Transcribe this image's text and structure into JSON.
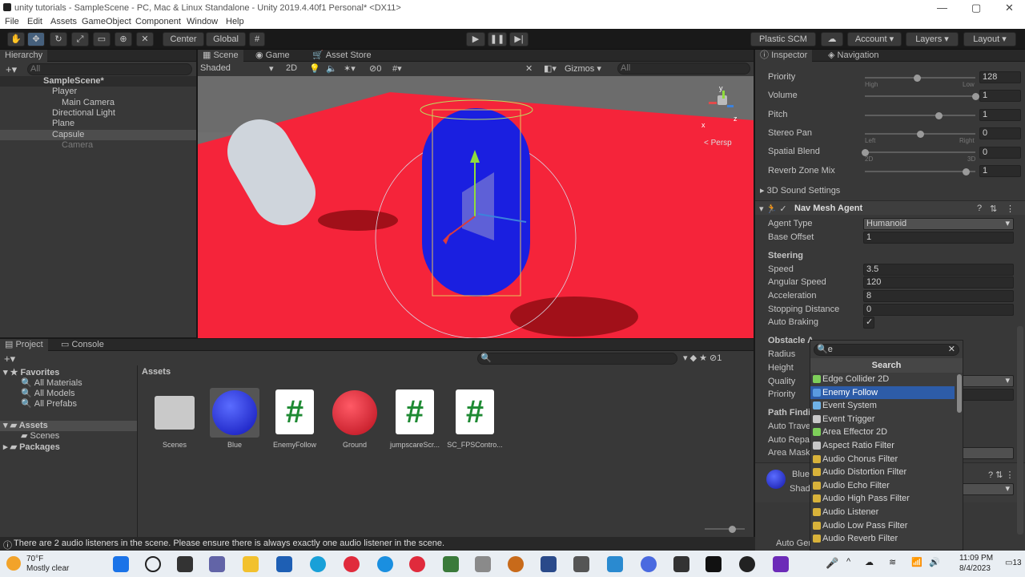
{
  "window": {
    "title": "unity tutorials - SampleScene - PC, Mac & Linux Standalone - Unity 2019.4.40f1 Personal* <DX11>"
  },
  "menu": [
    "File",
    "Edit",
    "Assets",
    "GameObject",
    "Component",
    "Window",
    "Help"
  ],
  "toolbar": {
    "center": "Center",
    "global": "Global",
    "plastic": "Plastic SCM",
    "account": "Account",
    "layers": "Layers",
    "layout": "Layout"
  },
  "hierarchy": {
    "tab": "Hierarchy",
    "search": "All",
    "scene": "SampleScene*",
    "items": [
      "Player",
      "Main Camera",
      "Directional Light",
      "Plane",
      "Capsule",
      "Camera"
    ]
  },
  "scene_view": {
    "tabs": [
      "Scene",
      "Game",
      "Asset Store"
    ],
    "shading": "Shaded",
    "mode2d": "2D",
    "fx_count": "0",
    "gizmos": "Gizmos",
    "search": "All",
    "persp": "< Persp",
    "axis_y": "y",
    "axis_x": "x",
    "axis_z": "z"
  },
  "inspector": {
    "tabs": [
      "Inspector",
      "Navigation"
    ],
    "audio": {
      "priority_label": "Priority",
      "priority": "128",
      "high": "High",
      "low": "Low",
      "priority_frac": 0.47,
      "volume_label": "Volume",
      "volume": "1",
      "volume_frac": 1.0,
      "pitch_label": "Pitch",
      "pitch": "1",
      "pitch_frac": 0.67,
      "stereo_label": "Stereo Pan",
      "stereo": "0",
      "left": "Left",
      "right": "Right",
      "stereo_frac": 0.5,
      "spatial_label": "Spatial Blend",
      "spatial": "0",
      "d2": "2D",
      "d3": "3D",
      "spatial_frac": 0.0,
      "reverb_label": "Reverb Zone Mix",
      "reverb": "1",
      "reverb_frac": 0.91,
      "sound3d": "3D Sound Settings"
    },
    "nav": {
      "title": "Nav Mesh Agent",
      "agent_type_label": "Agent Type",
      "agent_type": "Humanoid",
      "base_offset_label": "Base Offset",
      "base_offset": "1",
      "steering": "Steering",
      "speed_label": "Speed",
      "speed": "3.5",
      "angular_label": "Angular Speed",
      "angular": "120",
      "accel_label": "Acceleration",
      "accel": "8",
      "stopping_label": "Stopping Distance",
      "stopping": "0",
      "braking_label": "Auto Braking",
      "braking": "✓",
      "obstacle": "Obstacle A",
      "radius": "Radius",
      "height": "Height",
      "quality": "Quality",
      "priority": "Priority",
      "pathfind": "Path Findi",
      "autotrav": "Auto Trave",
      "autorep": "Auto Repat",
      "areamask": "Area Mask"
    },
    "material": {
      "name": "Blue",
      "shader": "Shad"
    },
    "autogen": "Auto Ger"
  },
  "dropdown": {
    "search": "e",
    "header": "Search",
    "items": [
      "Edge Collider 2D",
      "Enemy Follow",
      "Event System",
      "Event Trigger",
      "Area Effector 2D",
      "Aspect Ratio Filter",
      "Audio Chorus Filter",
      "Audio Distortion Filter",
      "Audio Echo Filter",
      "Audio High Pass Filter",
      "Audio Listener",
      "Audio Low Pass Filter",
      "Audio Reverb Filter"
    ],
    "colors": [
      "#7ecf5a",
      "#5a9be0",
      "#6fb2e6",
      "#c8c8c8",
      "#7ecf5a",
      "#c8c8c8",
      "#d8b23a",
      "#d8b23a",
      "#d8b23a",
      "#d8b23a",
      "#d8b23a",
      "#d8b23a",
      "#d8b23a"
    ],
    "selected": 1
  },
  "project": {
    "tabs": [
      "Project",
      "Console"
    ],
    "favorites": "Favorites",
    "fav_items": [
      "All Materials",
      "All Models",
      "All Prefabs"
    ],
    "assets_root": "Assets",
    "scenes": "Scenes",
    "packages": "Packages",
    "breadcrumb": "Assets",
    "count": "1",
    "assets": [
      {
        "name": "Scenes",
        "kind": "folder"
      },
      {
        "name": "Blue",
        "kind": "blue"
      },
      {
        "name": "EnemyFollow",
        "kind": "script"
      },
      {
        "name": "Ground",
        "kind": "red"
      },
      {
        "name": "jumpscareScr...",
        "kind": "script"
      },
      {
        "name": "SC_FPSContro...",
        "kind": "script"
      }
    ]
  },
  "status": "There are 2 audio listeners in the scene. Please ensure there is always exactly one audio listener in the scene.",
  "taskbar": {
    "temp": "70°F",
    "weather": "Mostly clear",
    "time": "11:09 PM",
    "date": "8/4/2023",
    "notif": "13"
  }
}
